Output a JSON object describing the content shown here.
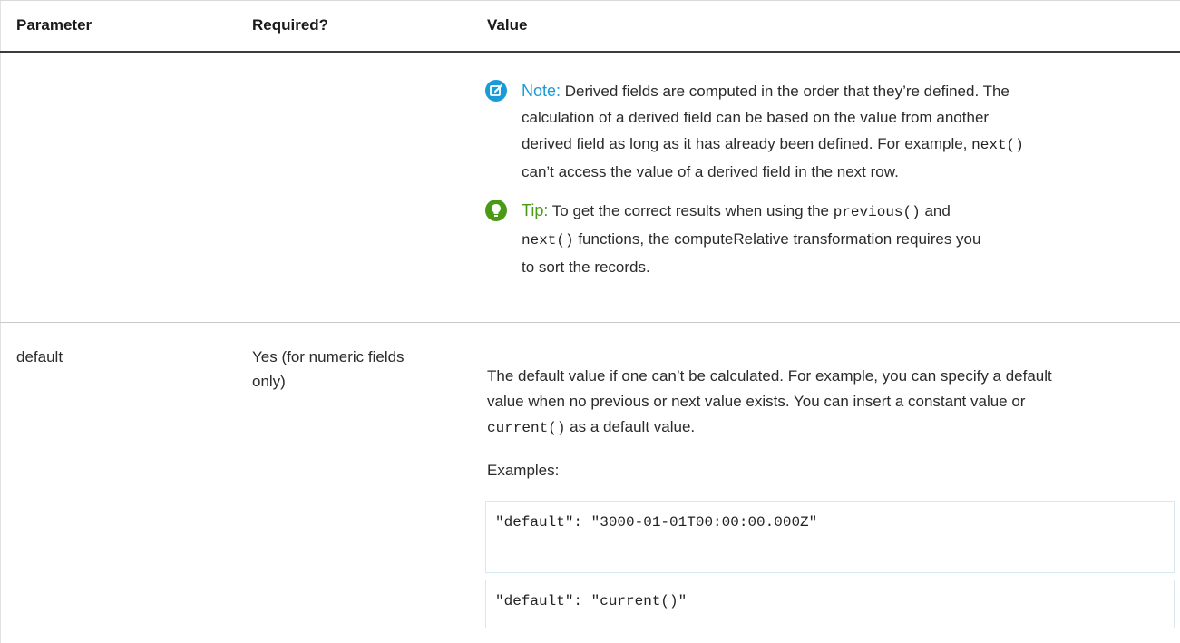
{
  "header": {
    "parameter": "Parameter",
    "required": "Required?",
    "value": "Value"
  },
  "note": {
    "icon": "note-edit-icon",
    "color": "#1a9ad6",
    "label": "Note:",
    "line1": " Derived fields are computed in the order that they’re defined. The",
    "line2": "calculation of a derived field can be based on the value from another",
    "line3": "derived field as long as it has already been defined. For example, ",
    "line3_code": "next()",
    "line4": "can’t access the value of a derived field in the next row."
  },
  "tip": {
    "icon": "lightbulb-icon",
    "color": "#4a9a16",
    "label": "Tip:",
    "line1a": " To get the correct results when using the ",
    "line1_code": "previous()",
    "line1b": " and",
    "line2_code": "next()",
    "line2b": " functions, the computeRelative transformation requires you",
    "line3": "to sort the records."
  },
  "row_default": {
    "parameter": "default",
    "required_line1": "Yes (for numeric fields",
    "required_line2": "only)",
    "desc_line1": "The default value if one can’t be calculated. For example, you can specify a default",
    "desc_line2": "value when no previous or next value exists. You can insert a constant value or",
    "desc_code": "current()",
    "desc_line3b": " as a default value.",
    "examples_label": "Examples:",
    "example1": "\"default\": \"3000-01-01T00:00:00.000Z\"",
    "example2": "\"default\": \"current()\""
  }
}
